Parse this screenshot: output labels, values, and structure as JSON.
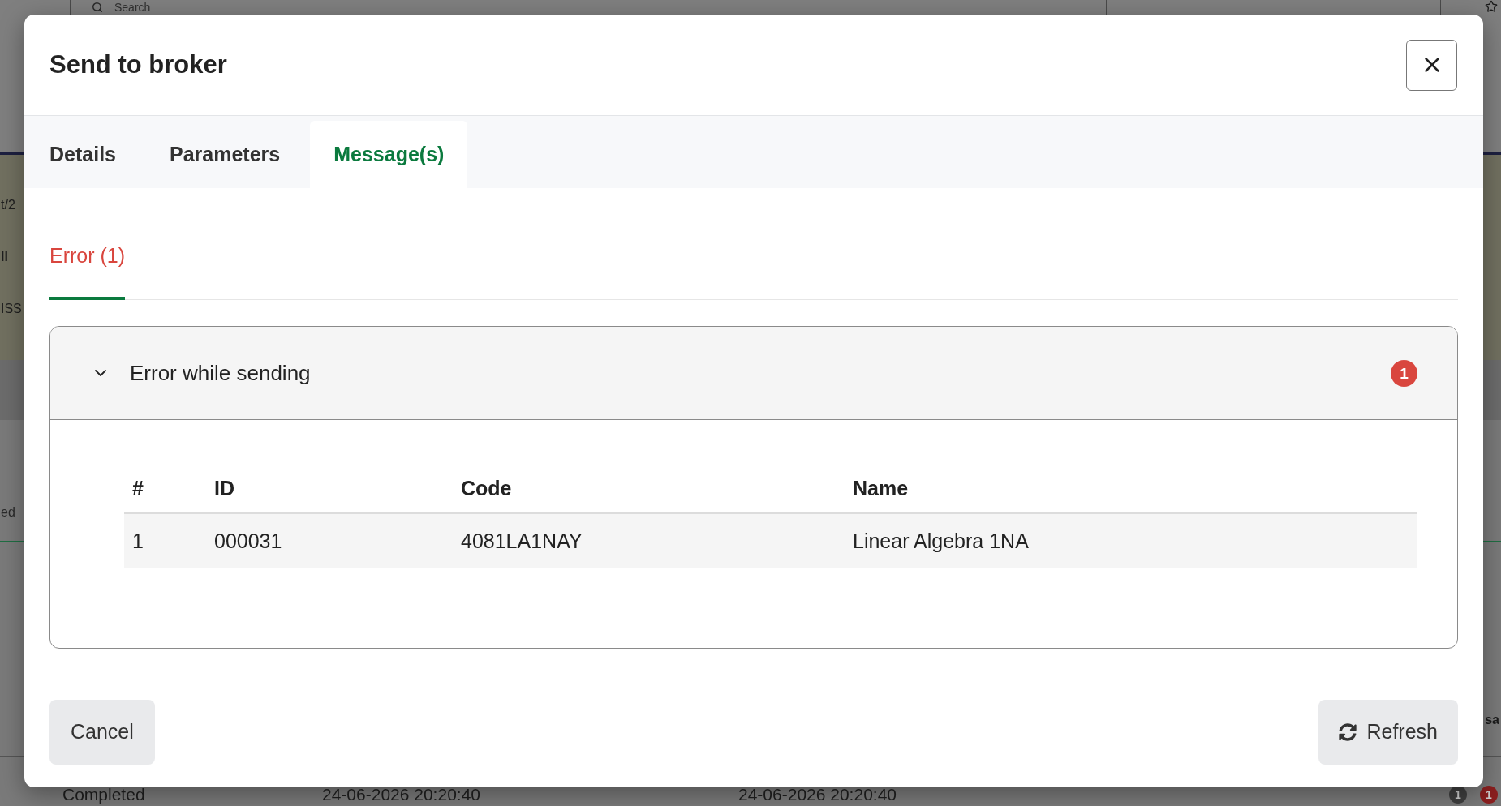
{
  "background": {
    "search": {
      "placeholder": "Search"
    },
    "banner": {
      "lines": [
        {
          "text": "t/2",
          "bold": false
        },
        {
          "text": "ll",
          "bold": true
        },
        {
          "text": "ISS",
          "bold": false
        }
      ]
    },
    "section_label": "ed",
    "side_label": "sa",
    "row": {
      "cells": [
        "Completed",
        "24-06-2026 20:20:40",
        "24-06-2026 20:20:40"
      ],
      "badges": [
        {
          "text": "1",
          "color": "#3f3f3f"
        },
        {
          "text": "1",
          "color": "#8b1f1f"
        }
      ]
    }
  },
  "dialog": {
    "title": "Send to broker",
    "tabs": [
      {
        "label": "Details",
        "selected": false
      },
      {
        "label": "Parameters",
        "selected": false
      },
      {
        "label": "Message(s)",
        "selected": true
      }
    ],
    "message_tabs": [
      {
        "label": "Error (1)",
        "selected": true
      }
    ],
    "groups": [
      {
        "title": "Error while sending",
        "expanded": true,
        "count": "1",
        "table": {
          "columns": [
            "#",
            "ID",
            "Code",
            "Name"
          ],
          "rows": [
            [
              "1",
              "000031",
              "4081LA1NAY",
              "Linear Algebra 1NA"
            ]
          ]
        }
      }
    ],
    "footer": {
      "buttons": [
        {
          "label": "Cancel",
          "kind": "plain"
        },
        {
          "label": "Refresh",
          "kind": "refresh"
        }
      ]
    }
  }
}
